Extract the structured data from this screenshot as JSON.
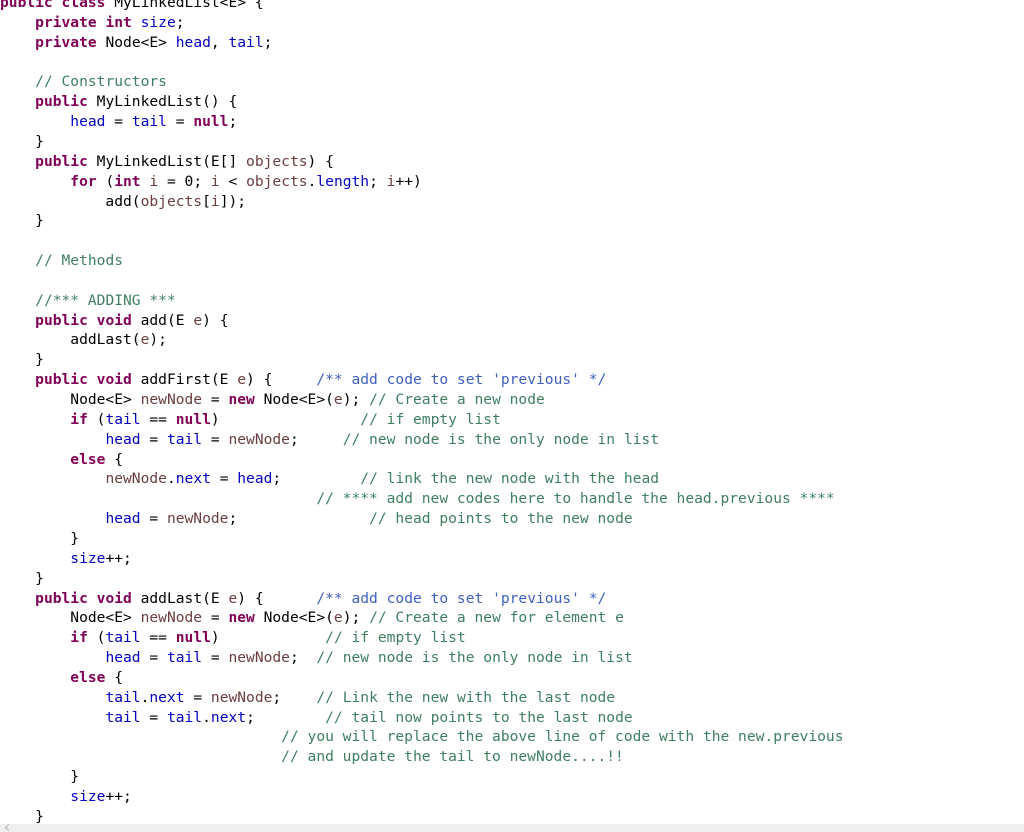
{
  "editor": {
    "language": "java",
    "colors": {
      "keyword": "#7f0055",
      "field": "#0000c0",
      "local": "#6a3e3e",
      "comment": "#3f7f5f",
      "javadoc": "#3f5fbf",
      "plain": "#000000"
    },
    "lines": [
      [
        [
          "kw",
          "public class"
        ],
        [
          "pl",
          " MyLinkedList<E> {"
        ]
      ],
      [
        [
          "pl",
          "    "
        ],
        [
          "kw",
          "private int"
        ],
        [
          "pl",
          " "
        ],
        [
          "fld",
          "size"
        ],
        [
          "pl",
          ";"
        ]
      ],
      [
        [
          "pl",
          "    "
        ],
        [
          "kw",
          "private"
        ],
        [
          "pl",
          " Node<E> "
        ],
        [
          "fld",
          "head"
        ],
        [
          "pl",
          ", "
        ],
        [
          "fld",
          "tail"
        ],
        [
          "pl",
          ";"
        ]
      ],
      [],
      [
        [
          "pl",
          "    "
        ],
        [
          "cm",
          "// Constructors"
        ]
      ],
      [
        [
          "pl",
          "    "
        ],
        [
          "kw",
          "public"
        ],
        [
          "pl",
          " MyLinkedList() {"
        ]
      ],
      [
        [
          "pl",
          "        "
        ],
        [
          "fld",
          "head"
        ],
        [
          "pl",
          " = "
        ],
        [
          "fld",
          "tail"
        ],
        [
          "pl",
          " = "
        ],
        [
          "kw",
          "null"
        ],
        [
          "pl",
          ";"
        ]
      ],
      [
        [
          "pl",
          "    }"
        ]
      ],
      [
        [
          "pl",
          "    "
        ],
        [
          "kw",
          "public"
        ],
        [
          "pl",
          " MyLinkedList(E[] "
        ],
        [
          "loc",
          "objects"
        ],
        [
          "pl",
          ") {"
        ]
      ],
      [
        [
          "pl",
          "        "
        ],
        [
          "kw",
          "for"
        ],
        [
          "pl",
          " ("
        ],
        [
          "kw",
          "int"
        ],
        [
          "pl",
          " "
        ],
        [
          "loc",
          "i"
        ],
        [
          "pl",
          " = 0; "
        ],
        [
          "loc",
          "i"
        ],
        [
          "pl",
          " < "
        ],
        [
          "loc",
          "objects"
        ],
        [
          "pl",
          "."
        ],
        [
          "fld",
          "length"
        ],
        [
          "pl",
          "; "
        ],
        [
          "loc",
          "i"
        ],
        [
          "pl",
          "++)"
        ]
      ],
      [
        [
          "pl",
          "            add("
        ],
        [
          "loc",
          "objects"
        ],
        [
          "pl",
          "["
        ],
        [
          "loc",
          "i"
        ],
        [
          "pl",
          "]);"
        ]
      ],
      [
        [
          "pl",
          "    }"
        ]
      ],
      [],
      [
        [
          "pl",
          "    "
        ],
        [
          "cm",
          "// Methods"
        ]
      ],
      [],
      [
        [
          "pl",
          "    "
        ],
        [
          "cm",
          "//*** ADDING ***"
        ]
      ],
      [
        [
          "pl",
          "    "
        ],
        [
          "kw",
          "public void"
        ],
        [
          "pl",
          " add(E "
        ],
        [
          "loc",
          "e"
        ],
        [
          "pl",
          ") {"
        ]
      ],
      [
        [
          "pl",
          "        addLast("
        ],
        [
          "loc",
          "e"
        ],
        [
          "pl",
          ");"
        ]
      ],
      [
        [
          "pl",
          "    }"
        ]
      ],
      [
        [
          "pl",
          "    "
        ],
        [
          "kw",
          "public void"
        ],
        [
          "pl",
          " addFirst(E "
        ],
        [
          "loc",
          "e"
        ],
        [
          "pl",
          ") {     "
        ],
        [
          "jd",
          "/** add code to set 'previous' */"
        ]
      ],
      [
        [
          "pl",
          "        Node<E> "
        ],
        [
          "loc",
          "newNode"
        ],
        [
          "pl",
          " = "
        ],
        [
          "kw",
          "new"
        ],
        [
          "pl",
          " Node<E>("
        ],
        [
          "loc",
          "e"
        ],
        [
          "pl",
          "); "
        ],
        [
          "cm",
          "// Create a new node"
        ]
      ],
      [
        [
          "pl",
          "        "
        ],
        [
          "kw",
          "if"
        ],
        [
          "pl",
          " ("
        ],
        [
          "fld",
          "tail"
        ],
        [
          "pl",
          " == "
        ],
        [
          "kw",
          "null"
        ],
        [
          "pl",
          ")                "
        ],
        [
          "cm",
          "// if empty list"
        ]
      ],
      [
        [
          "pl",
          "            "
        ],
        [
          "fld",
          "head"
        ],
        [
          "pl",
          " = "
        ],
        [
          "fld",
          "tail"
        ],
        [
          "pl",
          " = "
        ],
        [
          "loc",
          "newNode"
        ],
        [
          "pl",
          ";     "
        ],
        [
          "cm",
          "// new node is the only node in list"
        ]
      ],
      [
        [
          "pl",
          "        "
        ],
        [
          "kw",
          "else"
        ],
        [
          "pl",
          " {"
        ]
      ],
      [
        [
          "pl",
          "            "
        ],
        [
          "loc",
          "newNode"
        ],
        [
          "pl",
          "."
        ],
        [
          "fld",
          "next"
        ],
        [
          "pl",
          " = "
        ],
        [
          "fld",
          "head"
        ],
        [
          "pl",
          ";         "
        ],
        [
          "cm",
          "// link the new node with the head"
        ]
      ],
      [
        [
          "pl",
          "                                    "
        ],
        [
          "cm",
          "// **** add new codes here to handle the head.previous ****"
        ]
      ],
      [
        [
          "pl",
          "            "
        ],
        [
          "fld",
          "head"
        ],
        [
          "pl",
          " = "
        ],
        [
          "loc",
          "newNode"
        ],
        [
          "pl",
          ";               "
        ],
        [
          "cm",
          "// head points to the new node"
        ]
      ],
      [
        [
          "pl",
          "        }"
        ]
      ],
      [
        [
          "pl",
          "        "
        ],
        [
          "fld",
          "size"
        ],
        [
          "pl",
          "++;"
        ]
      ],
      [
        [
          "pl",
          "    }"
        ]
      ],
      [
        [
          "pl",
          "    "
        ],
        [
          "kw",
          "public void"
        ],
        [
          "pl",
          " addLast(E "
        ],
        [
          "loc",
          "e"
        ],
        [
          "pl",
          ") {      "
        ],
        [
          "jd",
          "/** add code to set 'previous' */"
        ]
      ],
      [
        [
          "pl",
          "        Node<E> "
        ],
        [
          "loc",
          "newNode"
        ],
        [
          "pl",
          " = "
        ],
        [
          "kw",
          "new"
        ],
        [
          "pl",
          " Node<E>("
        ],
        [
          "loc",
          "e"
        ],
        [
          "pl",
          "); "
        ],
        [
          "cm",
          "// Create a new for element e"
        ]
      ],
      [
        [
          "pl",
          "        "
        ],
        [
          "kw",
          "if"
        ],
        [
          "pl",
          " ("
        ],
        [
          "fld",
          "tail"
        ],
        [
          "pl",
          " == "
        ],
        [
          "kw",
          "null"
        ],
        [
          "pl",
          ")            "
        ],
        [
          "cm",
          "// if empty list"
        ]
      ],
      [
        [
          "pl",
          "            "
        ],
        [
          "fld",
          "head"
        ],
        [
          "pl",
          " = "
        ],
        [
          "fld",
          "tail"
        ],
        [
          "pl",
          " = "
        ],
        [
          "loc",
          "newNode"
        ],
        [
          "pl",
          ";  "
        ],
        [
          "cm",
          "// new node is the only node in list"
        ]
      ],
      [
        [
          "pl",
          "        "
        ],
        [
          "kw",
          "else"
        ],
        [
          "pl",
          " {"
        ]
      ],
      [
        [
          "pl",
          "            "
        ],
        [
          "fld",
          "tail"
        ],
        [
          "pl",
          "."
        ],
        [
          "fld",
          "next"
        ],
        [
          "pl",
          " = "
        ],
        [
          "loc",
          "newNode"
        ],
        [
          "pl",
          ";    "
        ],
        [
          "cm",
          "// Link the new with the last node"
        ]
      ],
      [
        [
          "pl",
          "            "
        ],
        [
          "fld",
          "tail"
        ],
        [
          "pl",
          " = "
        ],
        [
          "fld",
          "tail"
        ],
        [
          "pl",
          "."
        ],
        [
          "fld",
          "next"
        ],
        [
          "pl",
          ";        "
        ],
        [
          "cm",
          "// tail now points to the last node"
        ]
      ],
      [
        [
          "pl",
          "                                "
        ],
        [
          "cm",
          "// you will replace the above line of code with the new.previous"
        ]
      ],
      [
        [
          "pl",
          "                                "
        ],
        [
          "cm",
          "// and update the tail to newNode....!!"
        ]
      ],
      [
        [
          "pl",
          "        }"
        ]
      ],
      [
        [
          "pl",
          "        "
        ],
        [
          "fld",
          "size"
        ],
        [
          "pl",
          "++;"
        ]
      ],
      [
        [
          "pl",
          "    }"
        ]
      ]
    ]
  },
  "scrollbar": {
    "orientation": "horizontal",
    "icon": "chevron-left-icon"
  }
}
